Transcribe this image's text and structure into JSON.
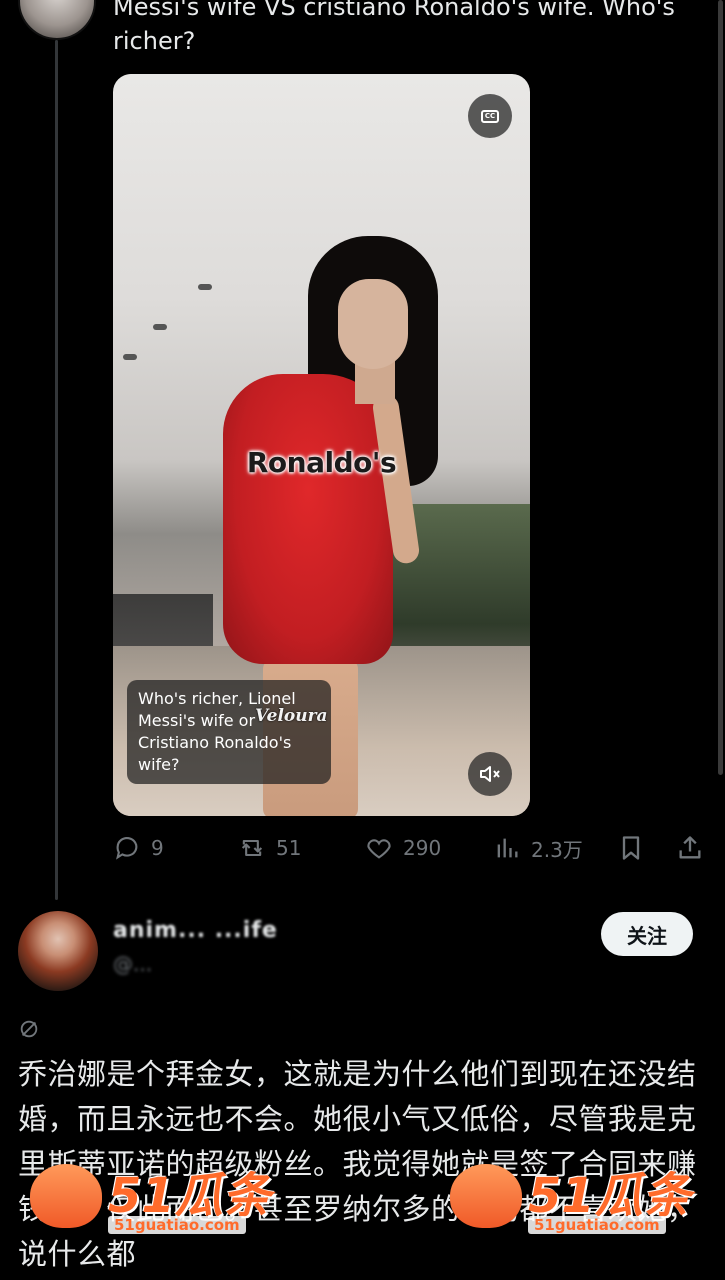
{
  "tweet": {
    "text": "Messi's wife VS cristiano Ronaldo's wife. Who's richer?"
  },
  "media": {
    "overlay_word": "Ronaldo's",
    "caption": "Who's richer, Lionel Messi's wife or Cristiano Ronaldo's wife?",
    "watermark": "Veloura",
    "cc_label": "CC",
    "cc_icon": "closed-captions-icon",
    "mute_icon": "speaker-muted-icon"
  },
  "actions": {
    "reply": {
      "icon": "reply-icon",
      "count": "9"
    },
    "retweet": {
      "icon": "retweet-icon",
      "count": "51"
    },
    "like": {
      "icon": "heart-icon",
      "count": "290"
    },
    "views": {
      "icon": "views-chart-icon",
      "count": "2.3万"
    },
    "bookmark": {
      "icon": "bookmark-icon"
    },
    "share": {
      "icon": "share-icon"
    }
  },
  "reply": {
    "name": "anim... ...ife",
    "handle": "@...",
    "follow_label": "关注",
    "text": "乔治娜是个拜金女，这就是为什么他们到现在还没结婚，而且永远也不会。她很小气又低俗，尽管我是克里斯蒂亚诺的超级粉丝。我觉得她就是签了合同来赚钱的，仅此而已。甚至罗纳尔多的妈妈都不喜欢她，说什么都"
  },
  "watermarks": [
    {
      "number": "51瓜条",
      "url": "51guatiao.com"
    },
    {
      "number": "51瓜条",
      "url": "51guatiao.com"
    }
  ],
  "colors": {
    "background": "#000000",
    "text": "#e7e9ea",
    "muted": "#71767b",
    "follow_bg": "#eff3f4",
    "watermark": "#ff6b2b"
  }
}
